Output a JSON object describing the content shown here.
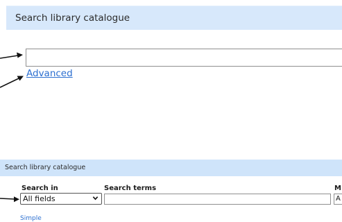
{
  "top_panel": {
    "title": "Search library catalogue",
    "search_value": "",
    "advanced_label": "Advanced"
  },
  "bottom_panel": {
    "title": "Search library catalogue",
    "search_in_label": "Search in",
    "search_in_selected": "All fields",
    "search_terms_label": "Search terms",
    "search_terms_value": "",
    "more_label": "M",
    "more_selected": "A",
    "simple_label": "Simple"
  },
  "colors": {
    "header_bg": "#d7e8fb",
    "link": "#2c6fd0",
    "arrow": "#111111"
  },
  "icons": {
    "select_chevron": "chevron-down-icon",
    "annotation": "arrow-icon"
  }
}
